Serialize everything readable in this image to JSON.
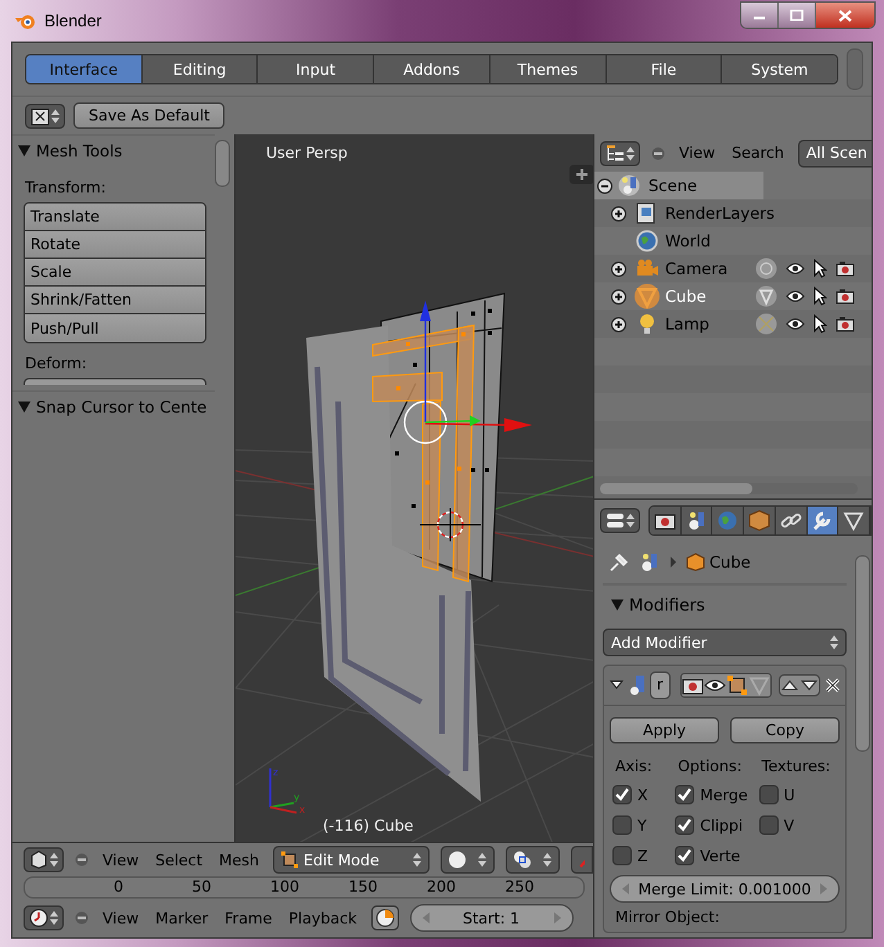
{
  "window": {
    "title": "Blender"
  },
  "prefs_tabs": [
    {
      "label": "Interface",
      "selected": true
    },
    {
      "label": "Editing",
      "selected": false
    },
    {
      "label": "Input",
      "selected": false
    },
    {
      "label": "Addons",
      "selected": false
    },
    {
      "label": "Themes",
      "selected": false
    },
    {
      "label": "File",
      "selected": false
    },
    {
      "label": "System",
      "selected": false
    }
  ],
  "save_button": "Save As Default",
  "tool_shelf": {
    "panels": [
      {
        "title": "Mesh Tools",
        "expanded": true,
        "section_label": "Transform:",
        "buttons": [
          "Translate",
          "Rotate",
          "Scale",
          "Shrink/Fatten",
          "Push/Pull"
        ],
        "next_section_label": "Deform:"
      },
      {
        "title": "Snap Cursor to Cente",
        "expanded": true
      }
    ]
  },
  "viewport": {
    "view_name": "User Persp",
    "object_label": "(-116) Cube",
    "axis_labels": [
      "z",
      "y",
      "x"
    ]
  },
  "outliner": {
    "menus": [
      "View",
      "Search"
    ],
    "display_mode": "All Scen",
    "tree": [
      {
        "name": "Scene",
        "kind": "scene",
        "expanded": true,
        "selected": true,
        "children": [
          {
            "name": "RenderLayers",
            "kind": "renderlayers",
            "expanded": false,
            "selected": false
          },
          {
            "name": "World",
            "kind": "world",
            "selected": false
          },
          {
            "name": "Camera",
            "kind": "camera",
            "expanded": false,
            "selected": false,
            "active": false
          },
          {
            "name": "Cube",
            "kind": "mesh",
            "expanded": false,
            "selected": false,
            "active": true
          },
          {
            "name": "Lamp",
            "kind": "lamp",
            "expanded": false,
            "selected": false,
            "active": false
          }
        ]
      }
    ]
  },
  "properties": {
    "context_tabs": [
      {
        "kind": "render",
        "selected": false
      },
      {
        "kind": "scene",
        "selected": false
      },
      {
        "kind": "world",
        "selected": false
      },
      {
        "kind": "object",
        "selected": false
      },
      {
        "kind": "constraints",
        "selected": false
      },
      {
        "kind": "modifiers",
        "selected": true
      },
      {
        "kind": "data",
        "selected": false
      }
    ],
    "breadcrumb": "Cube",
    "panel_title": "Modifiers",
    "panel_expanded": true,
    "add_modifier": "Add Modifier",
    "modifier": {
      "name": "r",
      "expanded": true,
      "apply": "Apply",
      "copy": "Copy",
      "columns": [
        {
          "label": "Axis:",
          "items": [
            {
              "label": "X",
              "checked": true
            },
            {
              "label": "Y",
              "checked": false
            },
            {
              "label": "Z",
              "checked": false
            }
          ]
        },
        {
          "label": "Options:",
          "items": [
            {
              "label": "Merge",
              "checked": true
            },
            {
              "label": "Clippi",
              "checked": true
            },
            {
              "label": "Verte",
              "checked": true
            }
          ]
        },
        {
          "label": "Textures:",
          "items": [
            {
              "label": "U",
              "checked": false
            },
            {
              "label": "V",
              "checked": false
            }
          ]
        }
      ],
      "merge_limit": "Merge Limit: 0.001000",
      "mirror_object_label": "Mirror Object:"
    }
  },
  "view3d_header": {
    "menus": [
      "View",
      "Select",
      "Mesh"
    ],
    "mode": "Edit Mode"
  },
  "timeline": {
    "ticks": [
      "0",
      "50",
      "100",
      "150",
      "200",
      "250"
    ],
    "menus": [
      "View",
      "Marker",
      "Frame",
      "Playback"
    ],
    "start": "Start: 1"
  }
}
